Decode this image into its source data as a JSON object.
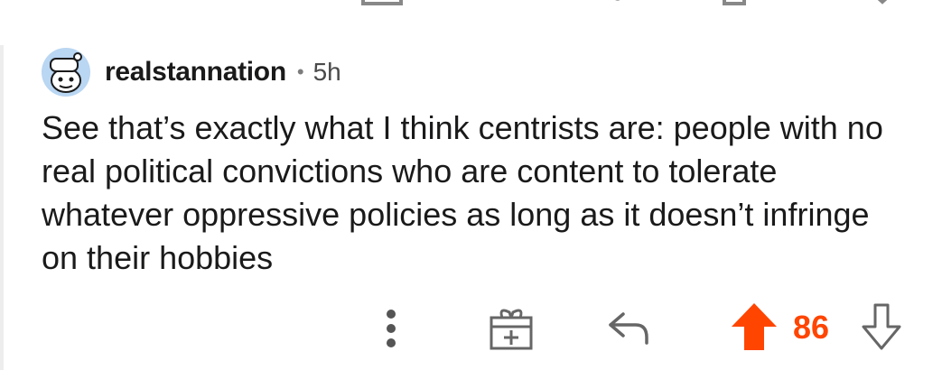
{
  "comment": {
    "username": "realstannation",
    "separator": "•",
    "age": "5h",
    "body": "See that’s exactly what I think centrists are: people with no real political convictions who are content to tolerate whatever oppressive policies as long as it doesn’t infringe on their hobbies",
    "score": "86"
  },
  "icons": {
    "avatar": "snoo-avatar-icon",
    "more": "more-vertical-icon",
    "award": "gift-icon",
    "reply": "reply-icon",
    "upvote": "upvote-icon",
    "downvote": "downvote-icon"
  },
  "colors": {
    "upvote": "#ff4500",
    "text": "#1a1a1b",
    "muted": "#7c7c7c",
    "avatar_bg": "#b9d6f2"
  }
}
